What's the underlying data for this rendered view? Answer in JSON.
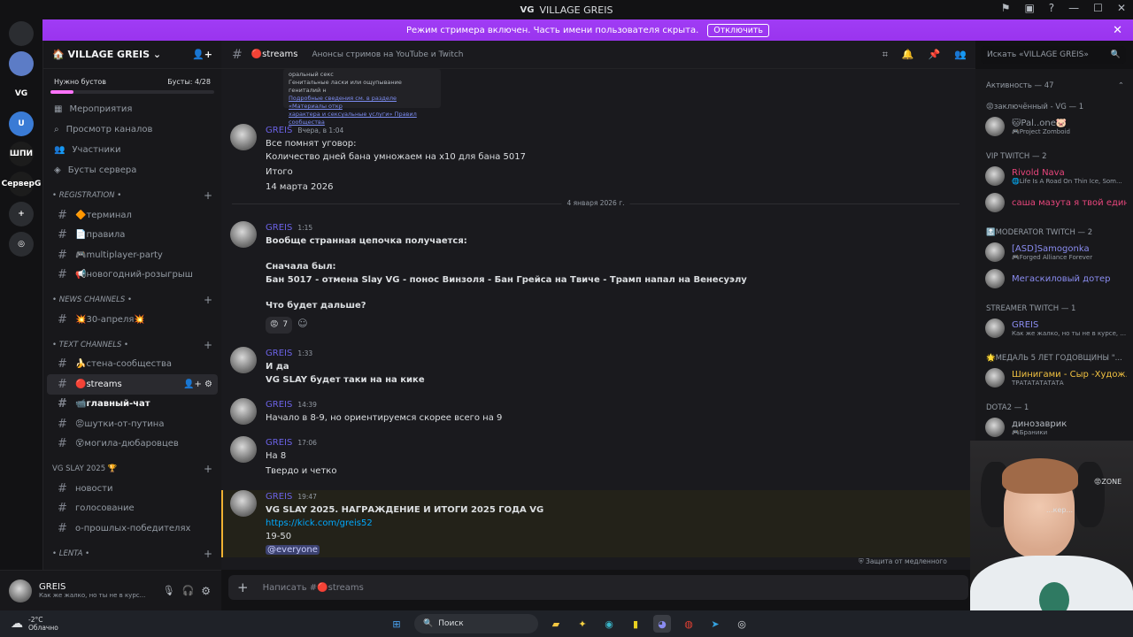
{
  "window": {
    "title": "VILLAGE GREIS"
  },
  "banner": {
    "text": "Режим стримера включен. Часть имени пользователя скрыта.",
    "button": "Отключить"
  },
  "servers": [
    {
      "label": "",
      "color": "#2b2d31",
      "icon": "discord-icon"
    },
    {
      "label": "",
      "color": "#5c7cc6",
      "icon": "avatar-server-icon"
    },
    {
      "label": "VG",
      "color": "#121214",
      "icon": "vg-server-icon"
    },
    {
      "label": "U",
      "color": "#3a7bd5",
      "icon": "u-server-icon"
    },
    {
      "label": "ШПИ",
      "color": "#1c1c1c",
      "icon": "text-server-icon"
    },
    {
      "label": "СерверG",
      "color": "#1c1c1c",
      "icon": "text-server-icon"
    },
    {
      "label": "+",
      "color": "#2b2d31",
      "icon": "add-server-icon"
    },
    {
      "label": "◎",
      "color": "#2b2d31",
      "icon": "discover-icon"
    }
  ],
  "guild": {
    "name": "VILLAGE GREIS",
    "boost_left": "Нужно бустов",
    "boost_right": "Бусты: 4/28"
  },
  "nav": [
    {
      "label": "Мероприятия",
      "icon": "calendar-icon"
    },
    {
      "label": "Просмотр каналов",
      "icon": "browse-icon"
    },
    {
      "label": "Участники",
      "icon": "members-icon"
    },
    {
      "label": "Бусты сервера",
      "icon": "boost-icon"
    }
  ],
  "categories": [
    {
      "name": "• REGISTRATION •",
      "channels": [
        "🔶терминал",
        "📄правила",
        "🎮multiplayer-party",
        "📢новогодний-розыгрыш"
      ]
    },
    {
      "name": "• NEWS CHANNELS •",
      "channels": [
        "💥30-апреля💥"
      ]
    },
    {
      "name": "• TEXT CHANNELS •",
      "channels": [
        "🍌стена-сообщества",
        "🔴streams",
        "📹главный-чат",
        "😡шутки-от-путина",
        "😵могила-дюбаровцев"
      ]
    },
    {
      "name": "VG SLAY 2025 🏆",
      "channels": [
        "новости",
        "голосование",
        "о-прошлых-победителях"
      ]
    },
    {
      "name": "• LENTA •",
      "channels": []
    }
  ],
  "user": {
    "name": "GREIS",
    "status": "Как же жалко, но ты не в курс..."
  },
  "channel_header": {
    "name": "🔴streams",
    "topic": "Анонсы стримов на YouTube и Twitch"
  },
  "search_placeholder": "Искать «VILLAGE GREIS»",
  "top_embed": {
    "line1": "оральный секс",
    "line2": "Генитальные ласки или ощупывание гениталий н",
    "line3": "Подробные сведения см. в разделе «Материалы откр",
    "line4": "характера и сексуальные услуги» Правил сообщества"
  },
  "messages": [
    {
      "user": "GREIS",
      "time": "Вчера, в 1:04",
      "lines": [
        "Все помнят уговор:",
        "Количество дней бана умножаем на х10 для бана 5017",
        "Итого",
        "14 марта 2026"
      ]
    },
    {
      "user": "GREIS",
      "time": "1:15",
      "lines": [
        "Вообще странная цепочка получается:",
        "Сначала был:",
        "Бан 5017 - отмена Slay VG - понос Винзоля - Бан Грейса на Твиче - Трамп напал на Венесуэлу",
        "Что будет дальше?"
      ],
      "reaction_count": "7"
    },
    {
      "user": "GREIS",
      "time": "1:33",
      "lines": [
        "И да",
        "VG SLAY будет таки на на кике"
      ]
    },
    {
      "user": "GREIS",
      "time": "14:39",
      "lines": [
        "Начало в 8-9, но ориентируемся скорее всего на 9"
      ]
    },
    {
      "user": "GREIS",
      "time": "17:06",
      "lines": [
        "На 8",
        "Твердо и четко"
      ]
    },
    {
      "user": "GREIS",
      "time": "19:47",
      "lines": [
        "VG SLAY 2025. НАГРАЖДЕНИЕ И ИТОГИ 2025 ГОДА VG",
        "https://kick.com/greis52",
        "19-50",
        "@everyone"
      ]
    }
  ],
  "date_divider": "4 января 2026 г.",
  "slowmode": "Защита от медленного",
  "composer_placeholder": "Написать #🔴streams",
  "members": {
    "activity": "Активность — 47",
    "groups": [
      {
        "title": "😡заключённый - VG — 1",
        "items": [
          {
            "name": "🐱Pal..one🐷",
            "sub": "🎮Project Zomboid",
            "color": "#949ba4"
          }
        ]
      },
      {
        "title": "VIP TWITCH — 2",
        "items": [
          {
            "name": "Rivold Nava",
            "sub": "🌐Life Is A Road On Thin Ice, Som...",
            "color": "#e8467c"
          },
          {
            "name": "саша мазута я твой един...",
            "sub": "",
            "color": "#e8467c"
          }
        ]
      },
      {
        "title": "🔝MODERATOR TWITCH — 2",
        "items": [
          {
            "name": "[ASD]Samogonka",
            "sub": "🎮Forged Alliance Forever",
            "color": "#8a8cf0"
          },
          {
            "name": "Мегаскиловый дотер",
            "sub": "",
            "color": "#8a8cf0"
          }
        ]
      },
      {
        "title": "STREAMER TWITCH — 1",
        "items": [
          {
            "name": "GREIS",
            "sub": "Как же жалко, но ты не в курсе, ...",
            "color": "#8a8cf0"
          }
        ]
      },
      {
        "title": "🌟МЕДАЛЬ 5 ЛЕТ ГОДОВЩИНЫ \"...",
        "items": [
          {
            "name": "Шинигами - Сыр -Худож...",
            "sub": "ТРАТАТАТАТАТА",
            "color": "#f0c040"
          }
        ]
      },
      {
        "title": "DOTA2 — 1",
        "items": [
          {
            "name": "динозаврик",
            "sub": "🎮Браники",
            "color": "#b5bac1"
          }
        ]
      }
    ],
    "partial_name": "...кер...",
    "zone_tag": "😡ZONE"
  },
  "taskbar": {
    "temp": "-2°C",
    "weather": "Облачно",
    "search": "Поиск"
  }
}
